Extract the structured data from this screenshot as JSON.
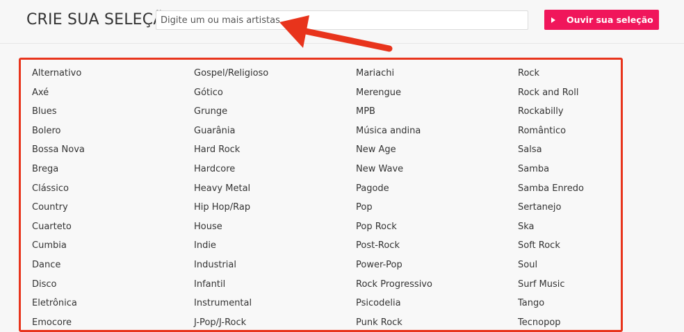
{
  "header": {
    "title": "CRIE SUA SELEÇÃO",
    "search_placeholder": "Digite um ou mais artistas",
    "listen_button_label": "Ouvir sua seleção"
  },
  "icons": {
    "play": "play-icon",
    "annotation_arrow": "arrow-icon"
  },
  "colors": {
    "accent": "#f0165b",
    "annotation_red": "#e8341c"
  },
  "genres": {
    "columns": [
      [
        "Alternativo",
        "Axé",
        "Blues",
        "Bolero",
        "Bossa Nova",
        "Brega",
        "Clássico",
        "Country",
        "Cuarteto",
        "Cumbia",
        "Dance",
        "Disco",
        "Eletrônica",
        "Emocore"
      ],
      [
        "Gospel/Religioso",
        "Gótico",
        "Grunge",
        "Guarânia",
        "Hard Rock",
        "Hardcore",
        "Heavy Metal",
        "Hip Hop/Rap",
        "House",
        "Indie",
        "Industrial",
        "Infantil",
        "Instrumental",
        "J-Pop/J-Rock"
      ],
      [
        "Mariachi",
        "Merengue",
        "MPB",
        "Música andina",
        "New Age",
        "New Wave",
        "Pagode",
        "Pop",
        "Pop Rock",
        "Post-Rock",
        "Power-Pop",
        "Rock Progressivo",
        "Psicodelia",
        "Punk Rock"
      ],
      [
        "Rock",
        "Rock and Roll",
        "Rockabilly",
        "Romântico",
        "Salsa",
        "Samba",
        "Samba Enredo",
        "Sertanejo",
        "Ska",
        "Soft Rock",
        "Soul",
        "Surf Music",
        "Tango",
        "Tecnopop"
      ]
    ]
  }
}
